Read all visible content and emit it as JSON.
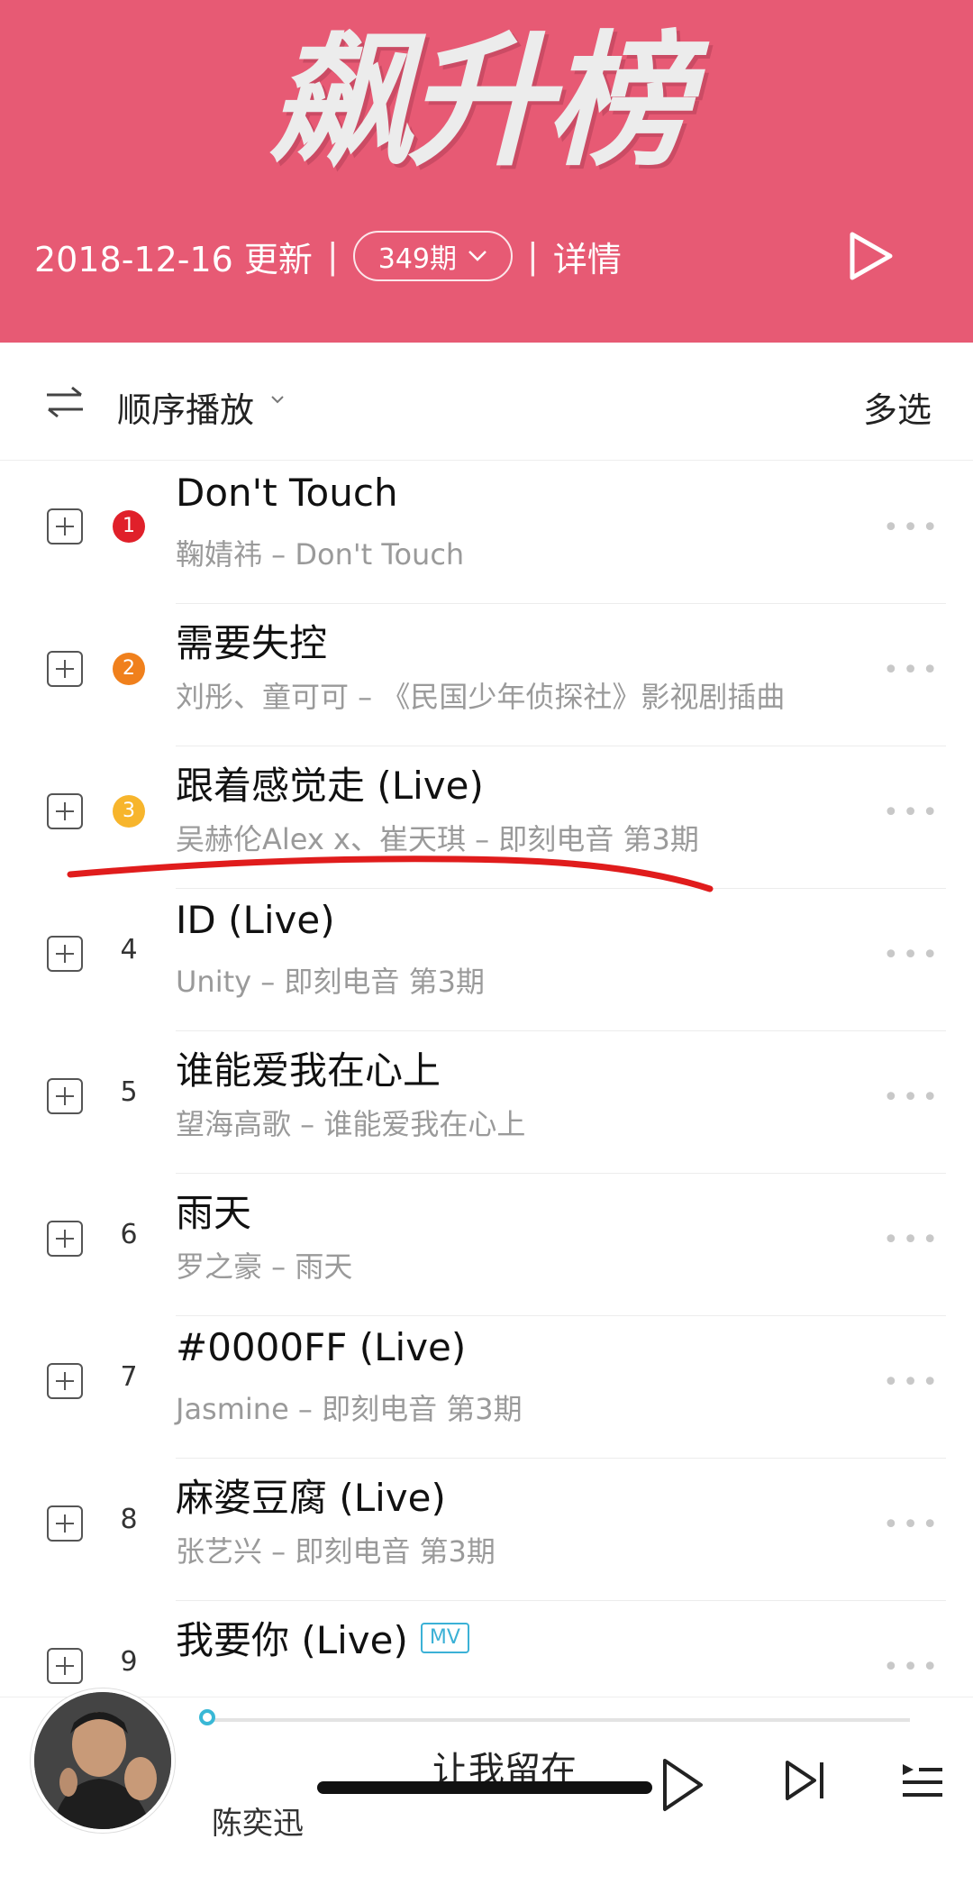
{
  "header": {
    "logo_text": "飙升榜",
    "date": "2018-12-16 更新",
    "issue": "349期",
    "detail": "详情",
    "background_color": "#e75a74"
  },
  "toolbar": {
    "order_label": "顺序播放",
    "multi_select": "多选",
    "order_icon": "shuffle-order-icon"
  },
  "songs": [
    {
      "rank": "1",
      "title": "Don't Touch",
      "subtitle": "鞠婧祎 – Don't Touch",
      "rank_color": "#e0202a"
    },
    {
      "rank": "2",
      "title": "需要失控",
      "subtitle": "刘彤、童可可 – 《民国少年侦探社》影视剧插曲",
      "rank_color": "#f0801c"
    },
    {
      "rank": "3",
      "title": "跟着感觉走 (Live)",
      "subtitle": "吴赫伦Alex x、崔天琪 – 即刻电音 第3期",
      "rank_color": "#f7b52c"
    },
    {
      "rank": "4",
      "title": "ID (Live)",
      "subtitle": "Unity – 即刻电音 第3期"
    },
    {
      "rank": "5",
      "title": "谁能爱我在心上",
      "subtitle": "望海高歌 – 谁能爱我在心上"
    },
    {
      "rank": "6",
      "title": "雨天",
      "subtitle": "罗之豪 – 雨天"
    },
    {
      "rank": "7",
      "title": "#0000FF (Live)",
      "subtitle": "Jasmine – 即刻电音 第3期"
    },
    {
      "rank": "8",
      "title": "麻婆豆腐 (Live)",
      "subtitle": "张艺兴 – 即刻电音 第3期"
    },
    {
      "rank": "9",
      "title": "我要你 (Live)",
      "badge": "MV",
      "subtitle": ""
    }
  ],
  "player": {
    "lyric": "让我留在",
    "artist": "陈奕迅",
    "progress": 0.0,
    "accent_color": "#39b8d6"
  }
}
